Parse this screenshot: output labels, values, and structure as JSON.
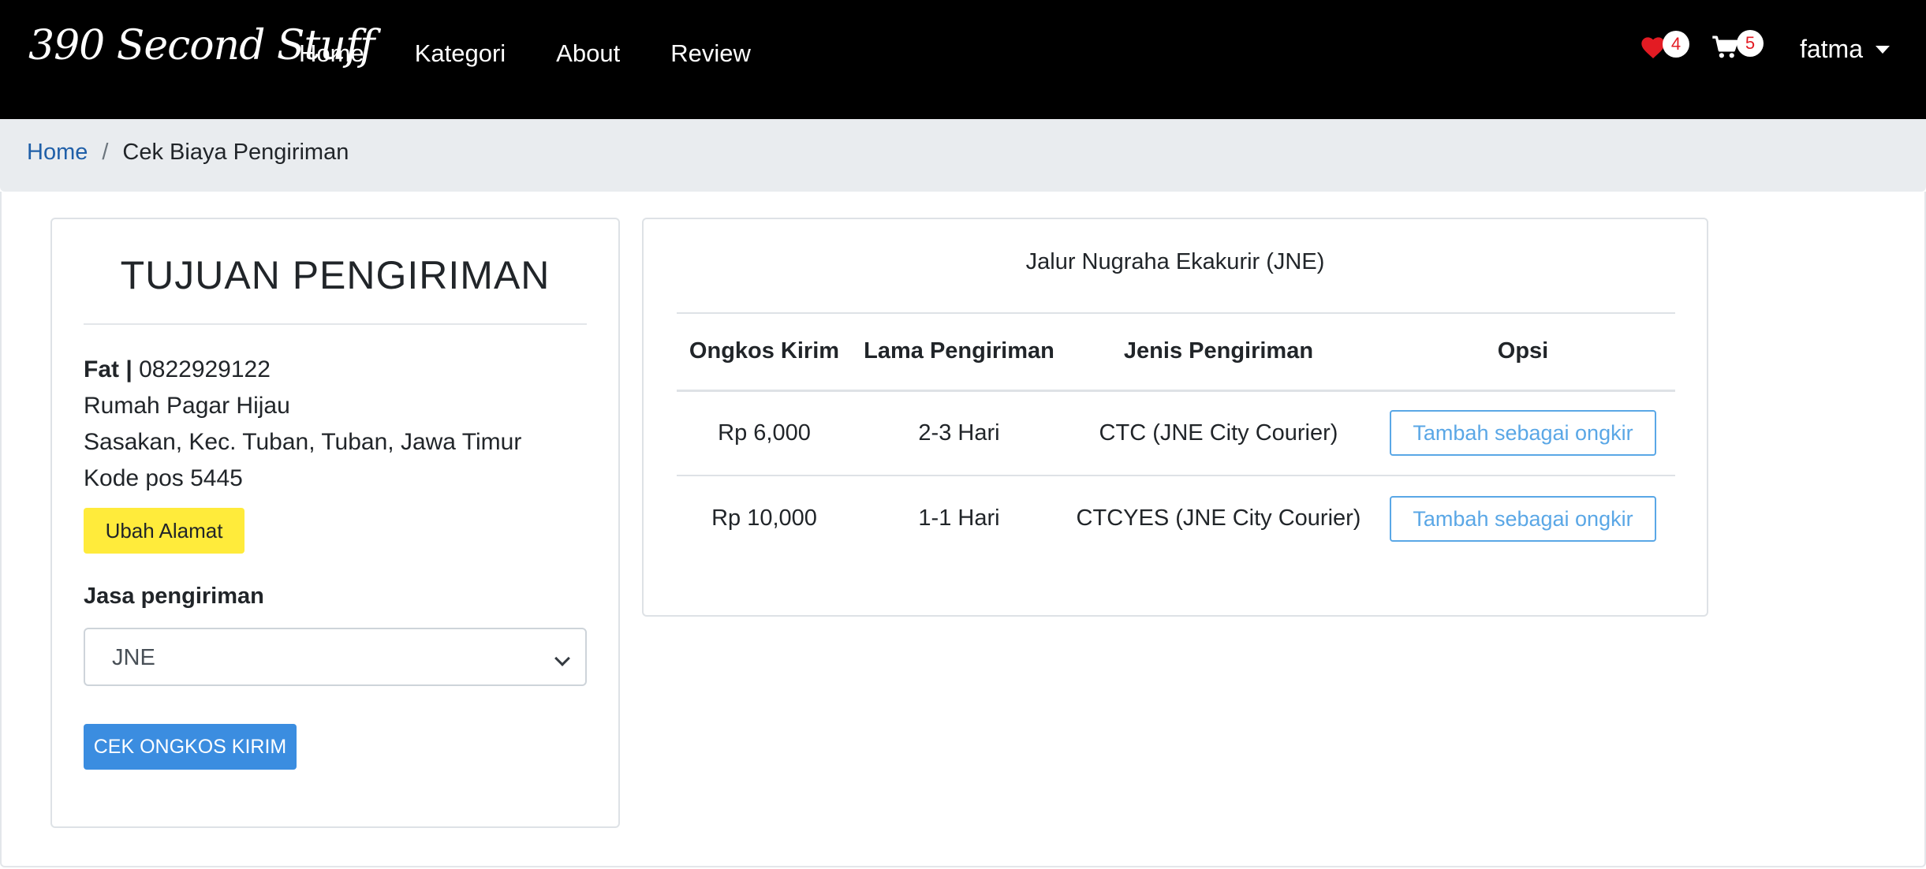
{
  "navbar": {
    "brand": "390 Second Stuff",
    "links": [
      "Home",
      "Kategori",
      "About",
      "Review"
    ],
    "wishlist_count": "4",
    "cart_count": "5",
    "user_name": "fatma"
  },
  "breadcrumb": {
    "home": "Home",
    "separator": "/",
    "current": "Cek Biaya Pengiriman"
  },
  "destination": {
    "title": "TUJUAN PENGIRIMAN",
    "name": "Fat",
    "separator": " | ",
    "phone": "0822929122",
    "address_line1": "Rumah Pagar Hijau",
    "address_line2": "Sasakan, Kec. Tuban, Tuban, Jawa Timur",
    "postal": "Kode pos 5445",
    "change_button": "Ubah Alamat",
    "courier_label": "Jasa pengiriman",
    "courier_selected": "JNE",
    "check_button": "CEK ONGKOS KIRIM"
  },
  "rates": {
    "courier_name": "Jalur Nugraha Ekakurir (JNE)",
    "headers": [
      "Ongkos Kirim",
      "Lama Pengiriman",
      "Jenis Pengiriman",
      "Opsi"
    ],
    "rows": [
      {
        "cost": "Rp 6,000",
        "duration": "2-3 Hari",
        "service": "CTC (JNE City Courier)",
        "action": "Tambah sebagai ongkir"
      },
      {
        "cost": "Rp 10,000",
        "duration": "1-1 Hari",
        "service": "CTCYES (JNE City Courier)",
        "action": "Tambah sebagai ongkir"
      }
    ]
  },
  "colors": {
    "navbar_bg": "#000000",
    "breadcrumb_bg": "#e9ecef",
    "link_blue": "#1f5fa8",
    "heart_red": "#e31b23",
    "yellow_button": "#ffeb3b",
    "primary_button": "#3b8de0",
    "outline_button": "#5aa7e6"
  },
  "icons": {
    "wishlist": "heart-icon",
    "cart": "cart-icon",
    "dropdown": "caret-down-icon"
  }
}
